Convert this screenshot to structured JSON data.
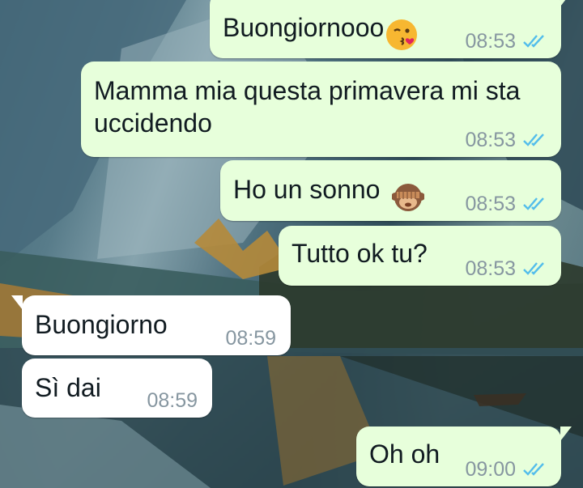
{
  "colors": {
    "outgoing_bubble": "#e7ffdb",
    "incoming_bubble": "#ffffff",
    "timestamp": "#8696a0",
    "read_ticks": "#53bdeb"
  },
  "messages": [
    {
      "direction": "outgoing",
      "text": "Buongiornooo",
      "emoji": "kissing-heart-emoji",
      "time": "08:53",
      "status": "read"
    },
    {
      "direction": "outgoing",
      "text": "Mamma mia questa primavera mi sta uccidendo",
      "time": "08:53",
      "status": "read"
    },
    {
      "direction": "outgoing",
      "text": "Ho un sonno",
      "emoji": "see-no-evil-monkey-emoji",
      "time": "08:53",
      "status": "read"
    },
    {
      "direction": "outgoing",
      "text": "Tutto ok tu?",
      "time": "08:53",
      "status": "read"
    },
    {
      "direction": "incoming",
      "text": "Buongiorno",
      "time": "08:59"
    },
    {
      "direction": "incoming",
      "text": "Sì dai",
      "time": "08:59"
    },
    {
      "direction": "outgoing",
      "text": "Oh oh",
      "time": "09:00",
      "status": "read"
    }
  ]
}
